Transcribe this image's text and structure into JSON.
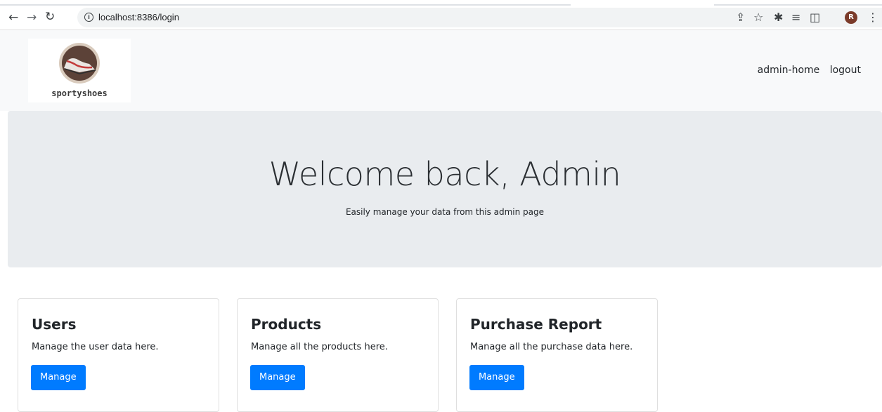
{
  "browser": {
    "url": "localhost:8386/login",
    "profile_initial": "R"
  },
  "navbar": {
    "logo_text": "sportyshoes",
    "links": [
      "admin-home",
      "logout"
    ]
  },
  "jumbotron": {
    "title": "Welcome back, Admin",
    "subtitle": "Easily manage your data from this admin page"
  },
  "cards": [
    {
      "title": "Users",
      "text": "Manage the user data here.",
      "button": "Manage"
    },
    {
      "title": "Products",
      "text": "Manage all the products here.",
      "button": "Manage"
    },
    {
      "title": "Purchase Report",
      "text": "Manage all the purchase data here.",
      "button": "Manage"
    }
  ],
  "colors": {
    "primary": "#007bff",
    "jumbotron_bg": "#e9ecef",
    "navbar_bg": "#f8f9fa"
  }
}
